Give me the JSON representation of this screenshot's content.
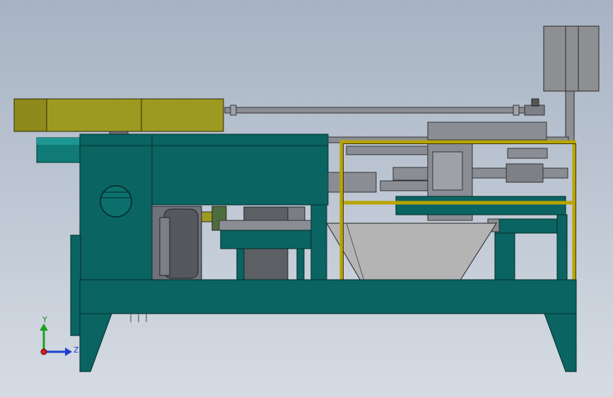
{
  "viewport": {
    "triad": {
      "y_label": "Y",
      "z_label": "Z"
    }
  },
  "colors": {
    "background_top": "#a7b3c3",
    "background_bottom": "#d6dce4",
    "frame_teal": "#0a6461",
    "motor_olive": "#9d9a22",
    "rail_yellow": "#b8a400",
    "steel_gray": "#8a8d94",
    "hopper_gray": "#b4b4b4",
    "triad_y": "#20a020",
    "triad_z": "#2040d0",
    "triad_x": "#d02020"
  }
}
